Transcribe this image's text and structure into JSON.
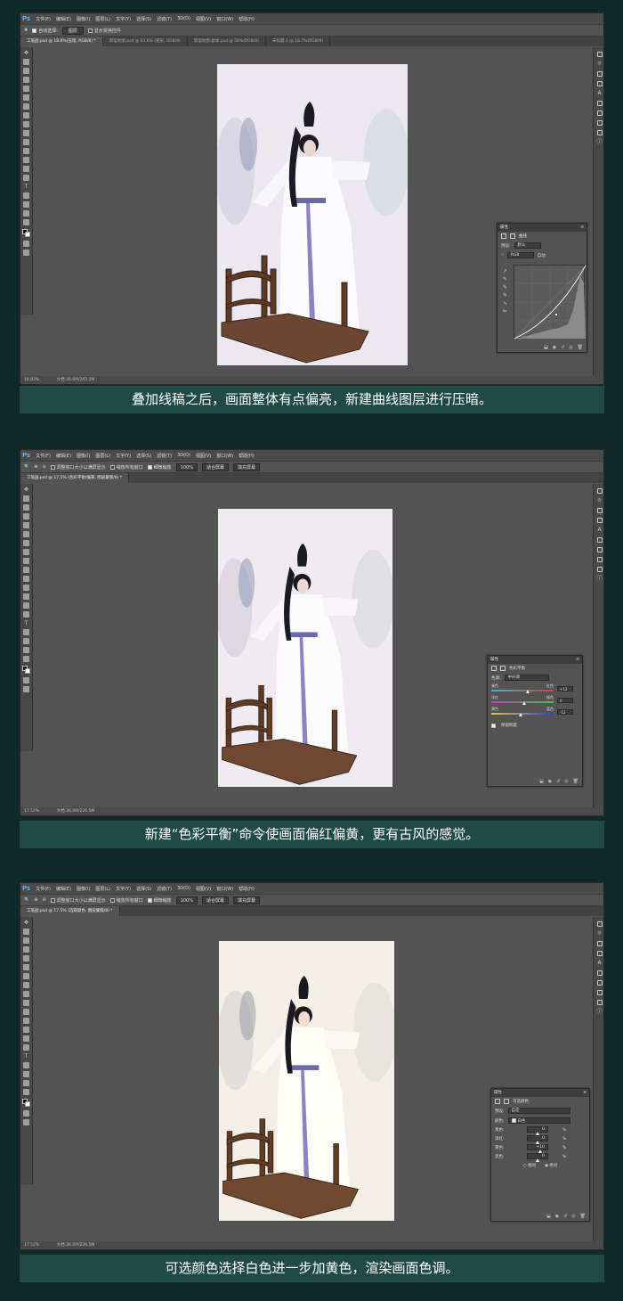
{
  "menu": {
    "logo": "Ps",
    "items": [
      "文件(F)",
      "编辑(E)",
      "图像(I)",
      "图层(L)",
      "文字(Y)",
      "选择(S)",
      "滤镜(T)",
      "3D(D)",
      "视图(V)",
      "窗口(W)",
      "帮助(H)"
    ]
  },
  "shot1": {
    "options": {
      "auto_select": "自动选择:",
      "layer_select": "图层",
      "show_transform": "显示变换控件"
    },
    "tabs": [
      "工笔画.psd @ 18.8%(压暗, RGB/8) *",
      "新宿地图.psd @ 63.6% (矩形, RGB/8)",
      "新宿地图-副本.psd @ 56%(RGB/8)",
      "未标题-1 @ 16.7%(RGB/8)"
    ],
    "status": {
      "zoom": "18.83%",
      "doc": "文档:36.6M/265.3M"
    },
    "panel": {
      "title": "属性",
      "subtitle": "曲线",
      "preset_label": "预设:",
      "preset_value": "默认",
      "channel": "RGB",
      "auto": "自动"
    },
    "caption": "叠加线稿之后，画面整体有点偏亮，新建曲线图层进行压暗。"
  },
  "shot2": {
    "options": {
      "resize": "调整窗口大小以满屏显示",
      "zoom_all": "缩放所有窗口",
      "scrubby": "细微缩放",
      "pct": "100%",
      "fit": "适合屏幕",
      "fill": "填充屏幕"
    },
    "tabs": [
      "工笔画.psd @ 17.5% (色彩平衡/偏黄, 图层蒙版/8) *"
    ],
    "status": {
      "zoom": "17.52%",
      "doc": "文档:36.6M/226.5M"
    },
    "panel": {
      "title": "属性",
      "subtitle": "色彩平衡",
      "tone_label": "色调:",
      "tone_value": "中间调",
      "sliders": [
        {
          "left": "青色",
          "right": "红色",
          "value": "+12",
          "pos": 0.56,
          "gradient": [
            "#3ab8c8",
            "#d83a3a"
          ]
        },
        {
          "left": "洋红",
          "right": "绿色",
          "value": "0",
          "pos": 0.5,
          "gradient": [
            "#c83ac8",
            "#3ac83a"
          ]
        },
        {
          "left": "黄色",
          "right": "蓝色",
          "value": "-12",
          "pos": 0.44,
          "gradient": [
            "#d8c83a",
            "#3a3ad8"
          ]
        }
      ],
      "preserve": "保留明度"
    },
    "caption": "新建“色彩平衡”命令使画面偏红偏黄，更有古风的感觉。"
  },
  "shot3": {
    "options": {
      "resize": "调整窗口大小以满屏显示",
      "zoom_all": "缩放所有窗口",
      "scrubby": "细微缩放",
      "pct": "100%",
      "fit": "适合屏幕",
      "fill": "填充屏幕"
    },
    "tabs": [
      "工笔画.psd @ 17.5% (选取颜色, 图层蒙版/8) *"
    ],
    "status": {
      "zoom": "17.52%",
      "doc": "文档:36.6M/226.5M"
    },
    "panel": {
      "title": "属性",
      "subtitle": "可选颜色",
      "preset_label": "预设:",
      "preset_value": "自定",
      "colors_label": "颜色:",
      "colors_value": "白色",
      "rows": [
        {
          "label": "青色:",
          "value": "0",
          "unit": "%",
          "pos": 0.5
        },
        {
          "label": "洋红:",
          "value": "0",
          "unit": "%",
          "pos": 0.5
        },
        {
          "label": "黄色:",
          "value": "+10",
          "unit": "%",
          "pos": 0.55
        },
        {
          "label": "黑色:",
          "value": "0",
          "unit": "%",
          "pos": 0.5
        }
      ],
      "relative": "相对",
      "absolute": "绝对"
    },
    "caption": "可选颜色选择白色进一步加黄色，渲染画面色调。"
  },
  "colors": {
    "bg": "#0f2a28",
    "caption_bg": "#1f4a45",
    "ps_gray": "#535353"
  },
  "photo_tints": {
    "shot1": "#ece8f2",
    "shot2": "#f0ebf1",
    "shot3": "#f3efe6"
  }
}
